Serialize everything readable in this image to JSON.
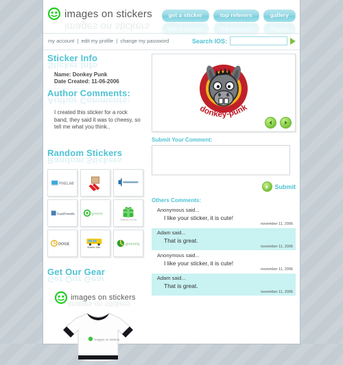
{
  "site": {
    "logo_text": "images on stickers",
    "logo_icon": "smiley-face-icon"
  },
  "nav": {
    "buttons": [
      {
        "label": "get a sticker",
        "name": "nav-get-a-sticker"
      },
      {
        "label": "top referers",
        "name": "nav-top-referers"
      },
      {
        "label": "gallery",
        "name": "nav-gallery"
      }
    ]
  },
  "account_bar": {
    "links": [
      "my account",
      "edit my profile",
      "change my password"
    ],
    "separator": "|",
    "search_label": "Search IOS:",
    "search_value": "",
    "search_placeholder": "",
    "go_icon": "green-play-arrow-icon"
  },
  "sticker_info": {
    "heading": "Sticker Info",
    "name_label": "Name:",
    "name_value": "Donkey Punk",
    "date_label": "Date Created:",
    "date_value": "11-06-2006"
  },
  "author_comments": {
    "heading": "Author Comments:",
    "body": "I created this sticker for a rock band, they said it was to cheesy, so tell me what you think.."
  },
  "viewer": {
    "sticker_title": "donkey-punk",
    "prev_icon": "left-arrow-icon",
    "next_icon": "right-arrow-icon"
  },
  "comment_form": {
    "heading": "Submit Your Comment:",
    "textarea_value": "",
    "textarea_placeholder": "",
    "submit_label": "Submit",
    "submit_icon": "green-play-button-icon"
  },
  "others_comments": {
    "heading": "Others Comments:",
    "items": [
      {
        "author": "Anonymous said...",
        "text": "I like your sticker, it is cute!",
        "date": "november 11, 2006",
        "highlight": false
      },
      {
        "author": "Adam said...",
        "text": "That is great.",
        "date": "november 11, 2006",
        "highlight": true
      },
      {
        "author": "Anonymous said...",
        "text": "I like your sticker, it is cute!",
        "date": "november 11, 2006",
        "highlight": false
      },
      {
        "author": "Adam said...",
        "text": "That is great.",
        "date": "november 11, 2006",
        "highlight": true
      }
    ]
  },
  "random_stickers": {
    "heading": "Random Stickers",
    "items": [
      {
        "name": "sticker-pixelab",
        "label": "PIXELAB"
      },
      {
        "name": "sticker-red-ribbon-box",
        "label": ""
      },
      {
        "name": "sticker-blue-bar-logo",
        "label": ""
      },
      {
        "name": "sticker-fastfreedom",
        "label": "FastFreedom"
      },
      {
        "name": "sticker-green-swirl",
        "label": ""
      },
      {
        "name": "sticker-green-gift",
        "label": "Smoke Em If You Got"
      },
      {
        "name": "sticker-doge",
        "label": "DOGE"
      },
      {
        "name": "sticker-yellow-bus",
        "label": "Shelter Star"
      },
      {
        "name": "sticker-green-apple",
        "label": "greenely"
      }
    ]
  },
  "gear": {
    "heading": "Get Our Gear",
    "logo_text": "images on stickers",
    "shirt_name": "tshirt-product-image",
    "shirt_logo_text": "images on stickers"
  },
  "colors": {
    "accent": "#4fc3d4",
    "nav_button": "#8fd6e2",
    "green": "#7cc63f",
    "highlight": "#c9f2f2",
    "page_bg": "#c3cdd3"
  }
}
